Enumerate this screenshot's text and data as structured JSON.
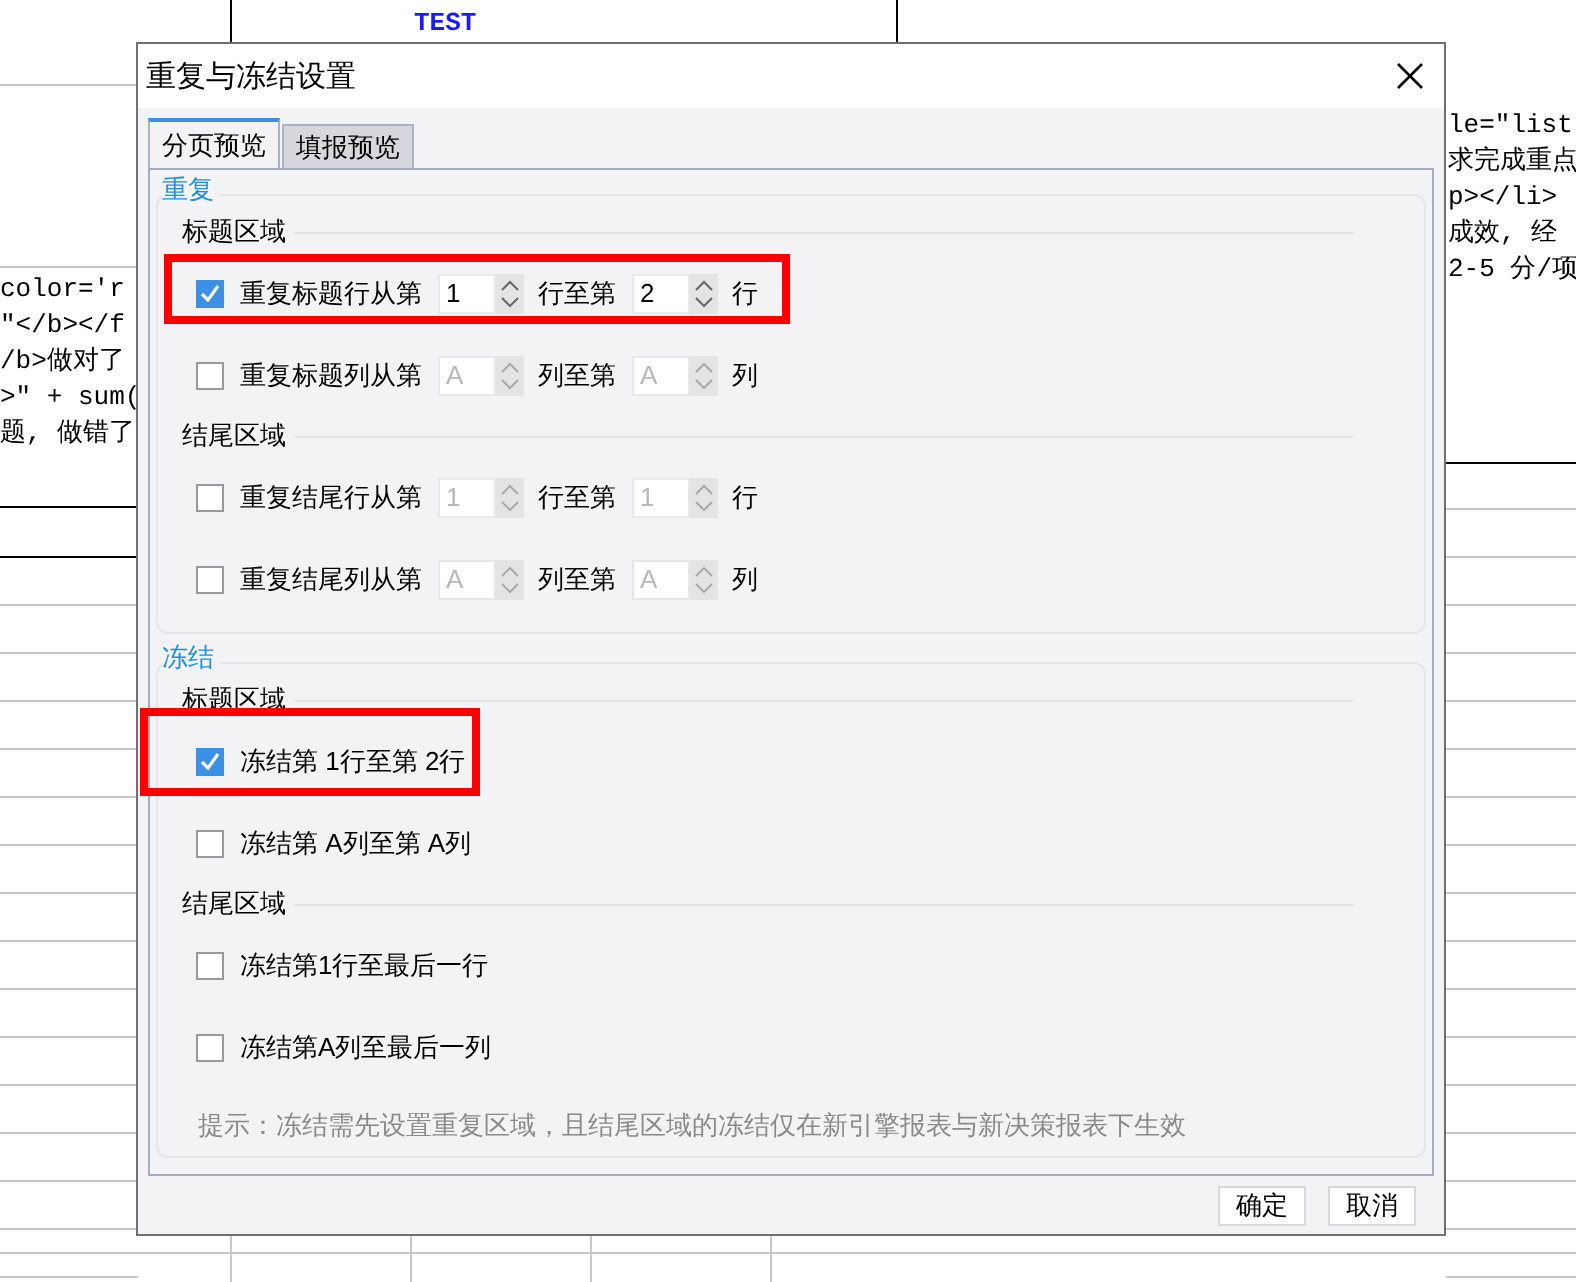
{
  "background": {
    "cell_text": "TEST",
    "code_left": [
      "color='r",
      "\"</b></f",
      "/b>做对了",
      ">\" + sum(",
      "题, 做错了"
    ],
    "code_right": [
      "le=\"list",
      "求完成重点",
      "p></li>",
      "成效, 经 ",
      "2-5 分/项"
    ]
  },
  "window": {
    "title": "重复与冻结设置"
  },
  "tabs": [
    {
      "label": "分页预览",
      "selected": true
    },
    {
      "label": "填报预览",
      "selected": false
    }
  ],
  "repeat": {
    "title": "重复",
    "groups": [
      {
        "title": "标题区域",
        "rows": [
          {
            "checked": true,
            "highlighted": true,
            "label": "重复标题行从第",
            "from": "1",
            "mid": "行至第",
            "to": "2",
            "unit": "行"
          },
          {
            "checked": false,
            "highlighted": false,
            "label": "重复标题列从第",
            "from": "A",
            "mid": "列至第",
            "to": "A",
            "unit": "列"
          }
        ]
      },
      {
        "title": "结尾区域",
        "rows": [
          {
            "checked": false,
            "highlighted": false,
            "label": "重复结尾行从第",
            "from": "1",
            "mid": "行至第",
            "to": "1",
            "unit": "行"
          },
          {
            "checked": false,
            "highlighted": false,
            "label": "重复结尾列从第",
            "from": "A",
            "mid": "列至第",
            "to": "A",
            "unit": "列"
          }
        ]
      }
    ]
  },
  "freeze": {
    "title": "冻结",
    "groups": [
      {
        "title": "标题区域",
        "rows": [
          {
            "checked": true,
            "highlighted": true,
            "label": "冻结第 1行至第 2行"
          },
          {
            "checked": false,
            "highlighted": false,
            "label": "冻结第 A列至第 A列"
          }
        ]
      },
      {
        "title": "结尾区域",
        "rows": [
          {
            "checked": false,
            "highlighted": false,
            "label": "冻结第1行至最后一行"
          },
          {
            "checked": false,
            "highlighted": false,
            "label": "冻结第A列至最后一列"
          }
        ]
      }
    ],
    "hint": "提示：冻结需先设置重复区域，且结尾区域的冻结仅在新引擎报表与新决策报表下生效"
  },
  "buttons": [
    "确定",
    "取消"
  ]
}
